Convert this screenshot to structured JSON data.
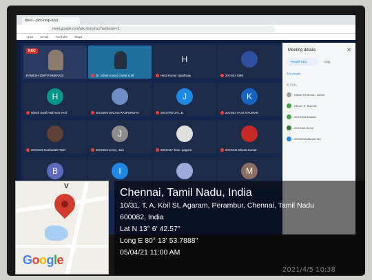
{
  "browser": {
    "tab_title": "Meet - (abc-hnrp-hxs)",
    "url": "meet.google.com/abc-hnrp-hxs?authuser=1",
    "bookmarks": [
      "Apps",
      "Gmail",
      "YouTube",
      "Maps"
    ]
  },
  "meeting": {
    "rec_label": "REC",
    "tiles": [
      {
        "label": "RAMESH GUPTA NEERADI",
        "avatar": ""
      },
      {
        "label": "Dr. Ashok Kumar Oswal & all",
        "avatar": ""
      },
      {
        "label": "Hindi Kumar Upadhyay",
        "avatar": "H"
      },
      {
        "label": "20CS01 Sahil",
        "avatar": ""
      },
      {
        "label": "Hitesh Sunil Patil Asst. Prof.",
        "avatar": "H"
      },
      {
        "label": "20CS003 MALAVI RAJPUROHIT",
        "avatar": ""
      },
      {
        "label": "20CSTN2 JA.L.B",
        "avatar": "J"
      },
      {
        "label": "20CS01 TA.SI S KUMAR",
        "avatar": "K"
      },
      {
        "label": "20CS125 Dasharath Patel",
        "avatar": ""
      },
      {
        "label": "20CS016 Jenny .Jain",
        "avatar": "J"
      },
      {
        "label": "20CS417 Jhon .pagoria",
        "avatar": ""
      },
      {
        "label": "20CS441 Bharat Kumar",
        "avatar": ""
      },
      {
        "label": "",
        "avatar": "B"
      },
      {
        "label": "",
        "avatar": "I"
      },
      {
        "label": "",
        "avatar": ""
      },
      {
        "label": "",
        "avatar": "M"
      }
    ]
  },
  "side_panel": {
    "title": "Meeting details",
    "close_icon": "close-icon",
    "tab_people": "People (46)",
    "tab_chat": "Chat",
    "add_people": "Add people",
    "section": "IN CALL",
    "participants": [
      "Hitesh B Parmar - Owner",
      "KALAY R. BUSHA",
      "20CS105 Sharath",
      "20CS115 Hemit",
      "20CS003 MALAVI RA"
    ]
  },
  "geotag": {
    "map_brand": "Google",
    "map_letter": "V",
    "city": "Chennai, Tamil Nadu, India",
    "address_line1": "10/31, T. A. Koil St, Agaram, Perambur, Chennai, Tamil Nadu",
    "address_line2": "600082, India",
    "lat": "Lat N 13° 6' 42.57\"",
    "long": "Long E 80° 13' 53.7888\"",
    "datetime": "05/04/21 11:00 AM"
  },
  "camera_timestamp": "2021/4/5  10:38",
  "colors": {
    "pin": "#d23c2f",
    "panel_bg": "#f5f6f7",
    "meet_bg": "#13274e"
  }
}
